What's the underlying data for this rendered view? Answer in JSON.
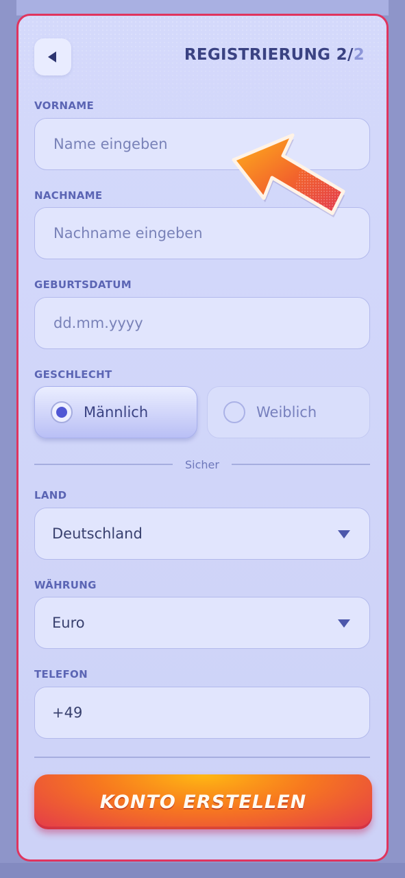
{
  "header": {
    "title": "REGISTRIERUNG 2/",
    "step_total": "2"
  },
  "form": {
    "first_name": {
      "label": "VORNAME",
      "placeholder": "Name eingeben"
    },
    "last_name": {
      "label": "NACHNAME",
      "placeholder": "Nachname eingeben"
    },
    "birthdate": {
      "label": "GEBURTSDATUM",
      "placeholder": "dd.mm.yyyy"
    },
    "gender": {
      "label": "GESCHLECHT",
      "options": [
        {
          "label": "Männlich",
          "selected": true
        },
        {
          "label": "Weiblich",
          "selected": false
        }
      ]
    },
    "divider_text": "Sicher",
    "country": {
      "label": "LAND",
      "value": "Deutschland"
    },
    "currency": {
      "label": "WÄHRUNG",
      "value": "Euro"
    },
    "phone": {
      "label": "TELEFON",
      "value": "+49"
    }
  },
  "cta": {
    "label": "KONTO ERSTELLEN"
  },
  "colors": {
    "accent": "#e0345e",
    "primary_text": "#3a4282",
    "label": "#5b65b4",
    "cta_start": "#ffb813",
    "cta_end": "#e33a4b"
  },
  "icons": {
    "back": "chevron-left-icon",
    "dropdown": "chevron-down-icon",
    "pointer": "arrow-pointer-icon"
  }
}
